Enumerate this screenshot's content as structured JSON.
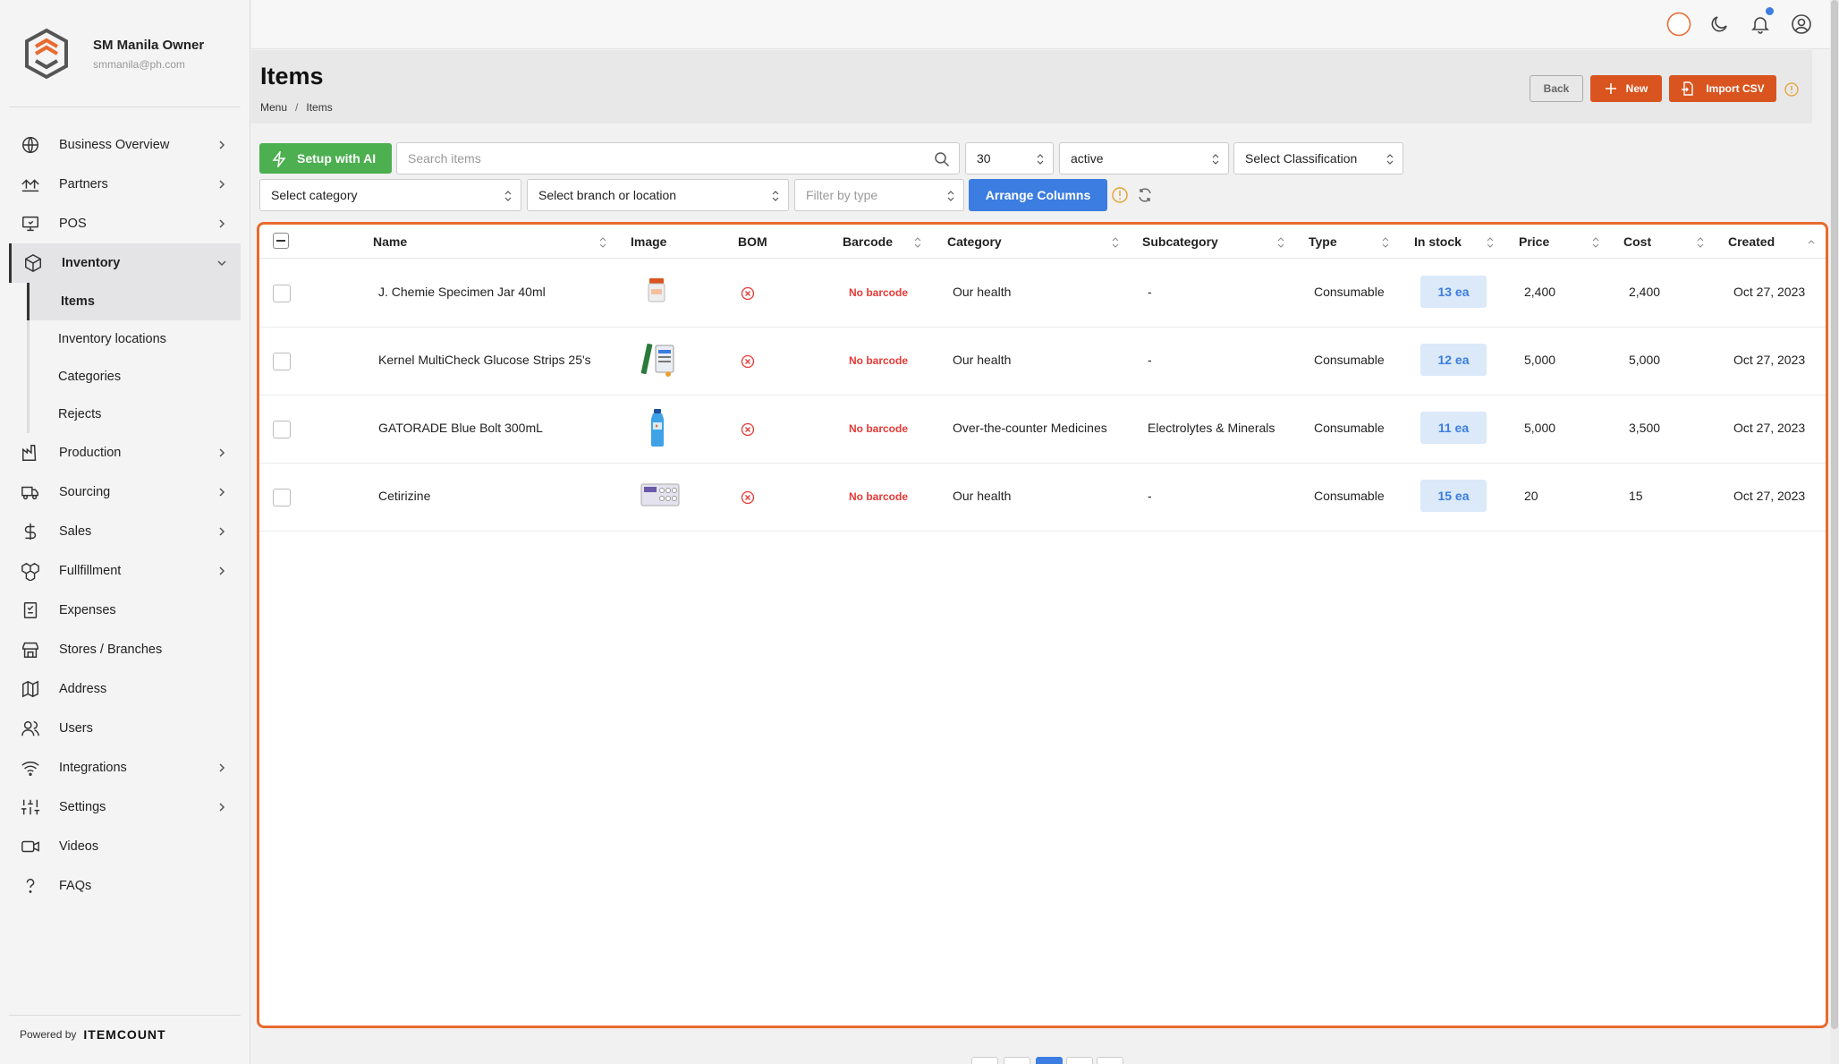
{
  "account": {
    "name": "SM Manila Owner",
    "email": "smmanila@ph.com"
  },
  "nav": {
    "items": [
      {
        "label": "Business Overview",
        "icon": "globe-icon",
        "chevron": true
      },
      {
        "label": "Partners",
        "icon": "partners-icon",
        "chevron": true
      },
      {
        "label": "POS",
        "icon": "pos-icon",
        "chevron": true
      },
      {
        "label": "Inventory",
        "icon": "box-icon",
        "chevron": true,
        "expanded": true
      },
      {
        "label": "Production",
        "icon": "factory-icon",
        "chevron": true
      },
      {
        "label": "Sourcing",
        "icon": "truck-icon",
        "chevron": true
      },
      {
        "label": "Sales",
        "icon": "dollar-icon",
        "chevron": true
      },
      {
        "label": "Fullfillment",
        "icon": "boxes-icon",
        "chevron": true
      },
      {
        "label": "Expenses",
        "icon": "receipt-icon",
        "chevron": false
      },
      {
        "label": "Stores / Branches",
        "icon": "store-icon",
        "chevron": false
      },
      {
        "label": "Address",
        "icon": "map-icon",
        "chevron": false
      },
      {
        "label": "Users",
        "icon": "users-icon",
        "chevron": false
      },
      {
        "label": "Integrations",
        "icon": "wifi-icon",
        "chevron": true
      },
      {
        "label": "Settings",
        "icon": "sliders-icon",
        "chevron": true
      },
      {
        "label": "Videos",
        "icon": "video-icon",
        "chevron": false
      },
      {
        "label": "FAQs",
        "icon": "question-icon",
        "chevron": false
      }
    ],
    "inventory_sub": [
      "Items",
      "Inventory locations",
      "Categories",
      "Rejects"
    ],
    "active_sub": "Items"
  },
  "footer": {
    "powered_by": "Powered by",
    "brand": "ITEMCOUNT"
  },
  "header": {
    "title": "Items",
    "breadcrumb": [
      "Menu",
      "Items"
    ],
    "back_label": "Back",
    "new_label": "New",
    "import_label": "Import CSV"
  },
  "filters": {
    "ai_label": "Setup with AI",
    "search_placeholder": "Search items",
    "page_size": "30",
    "status": "active",
    "classification": "Select Classification",
    "category": "Select category",
    "branch": "Select branch or location",
    "type_placeholder": "Filter by type",
    "arrange_label": "Arrange Columns"
  },
  "table": {
    "columns": [
      "Name",
      "Image",
      "BOM",
      "Barcode",
      "Category",
      "Subcategory",
      "Type",
      "In stock",
      "Price",
      "Cost",
      "Created"
    ],
    "rows": [
      {
        "name": "J. Chemie Specimen Jar 40ml",
        "barcode": "No barcode",
        "category": "Our health",
        "subcategory": "-",
        "type": "Consumable",
        "stock": "13 ea",
        "price": "2,400",
        "cost": "2,400",
        "created": "Oct 27, 2023",
        "image": "jar-image"
      },
      {
        "name": "Kernel MultiCheck Glucose Strips 25's",
        "barcode": "No barcode",
        "category": "Our health",
        "subcategory": "-",
        "type": "Consumable",
        "stock": "12 ea",
        "price": "5,000",
        "cost": "5,000",
        "created": "Oct 27, 2023",
        "image": "strips-image"
      },
      {
        "name": "GATORADE Blue Bolt 300mL",
        "barcode": "No barcode",
        "category": "Over-the-counter Medicines",
        "subcategory": "Electrolytes & Minerals",
        "type": "Consumable",
        "stock": "11 ea",
        "price": "5,000",
        "cost": "3,500",
        "created": "Oct 27, 2023",
        "image": "bottle-image"
      },
      {
        "name": "Cetirizine",
        "barcode": "No barcode",
        "category": "Our health",
        "subcategory": "-",
        "type": "Consumable",
        "stock": "15 ea",
        "price": "20",
        "cost": "15",
        "created": "Oct 27, 2023",
        "image": "blister-image"
      }
    ]
  },
  "colors": {
    "accent_orange": "#d9541f",
    "accent_blue": "#3b7de0",
    "accent_green": "#4caf50",
    "error_red": "#e53935"
  }
}
